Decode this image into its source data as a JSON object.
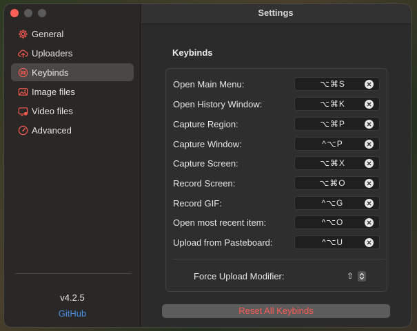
{
  "window": {
    "title": "Settings"
  },
  "sidebar": {
    "items": [
      {
        "label": "General",
        "icon": "gear-icon",
        "active": false
      },
      {
        "label": "Uploaders",
        "icon": "cloud-upload-icon",
        "active": false
      },
      {
        "label": "Keybinds",
        "icon": "command-icon",
        "active": true
      },
      {
        "label": "Image files",
        "icon": "image-icon",
        "active": false
      },
      {
        "label": "Video files",
        "icon": "video-icon",
        "active": false
      },
      {
        "label": "Advanced",
        "icon": "gauge-icon",
        "active": false
      }
    ],
    "version": "v4.2.5",
    "github": "GitHub"
  },
  "main": {
    "section_title": "Keybinds",
    "keybinds": [
      {
        "label": "Open Main Menu:",
        "shortcut": "⌥⌘S"
      },
      {
        "label": "Open History Window:",
        "shortcut": "⌥⌘K"
      },
      {
        "label": "Capture Region:",
        "shortcut": "⌥⌘P"
      },
      {
        "label": "Capture Window:",
        "shortcut": "^⌥P"
      },
      {
        "label": "Capture Screen:",
        "shortcut": "⌥⌘X"
      },
      {
        "label": "Record Screen:",
        "shortcut": "⌥⌘O"
      },
      {
        "label": "Record GIF:",
        "shortcut": "^⌥G"
      },
      {
        "label": "Open most recent item:",
        "shortcut": "^⌥O"
      },
      {
        "label": "Upload from Pasteboard:",
        "shortcut": "^⌥U"
      }
    ],
    "force_upload": {
      "label": "Force Upload Modifier:",
      "value": "⇧"
    },
    "reset_label": "Reset All Keybinds"
  },
  "colors": {
    "accent_link": "#4a90e2",
    "danger": "#ff5b52",
    "close_button": "#fe5f57"
  }
}
